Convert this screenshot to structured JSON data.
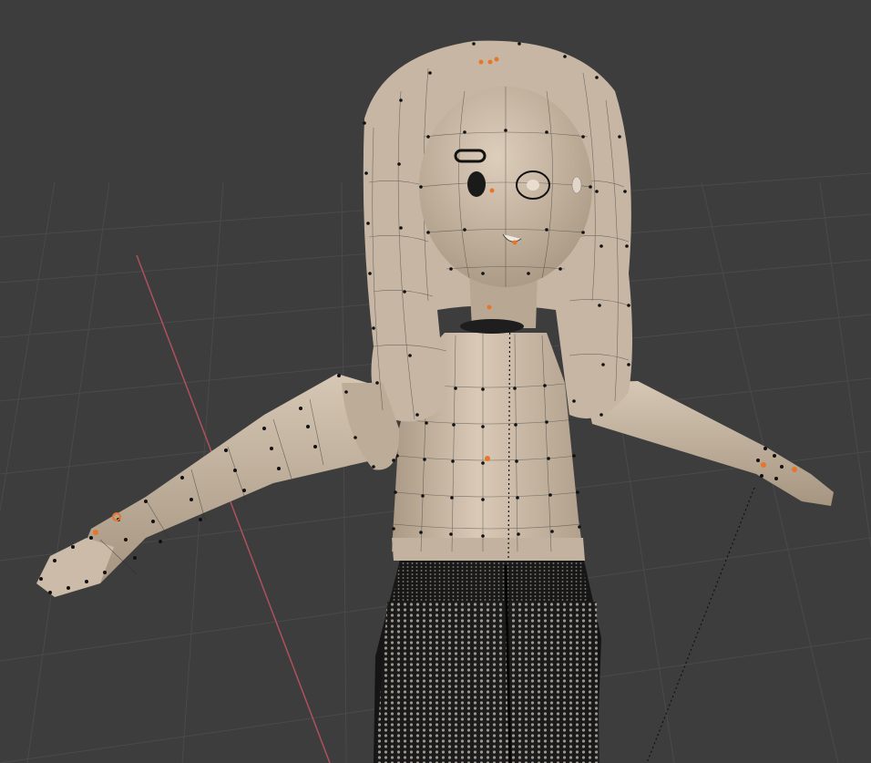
{
  "viewport": {
    "editor": "3d-viewport",
    "mode": "edit-mode",
    "shading": "solid",
    "background_color": "#3d3d3d",
    "grid_color": "#4a4a4a",
    "x_axis_color": "#b0505d",
    "mesh_color": "#cdbdab",
    "vertex_color": "#111111",
    "selected_vertex_color": "#e8752a",
    "pants_color": "#1b1b1b"
  }
}
